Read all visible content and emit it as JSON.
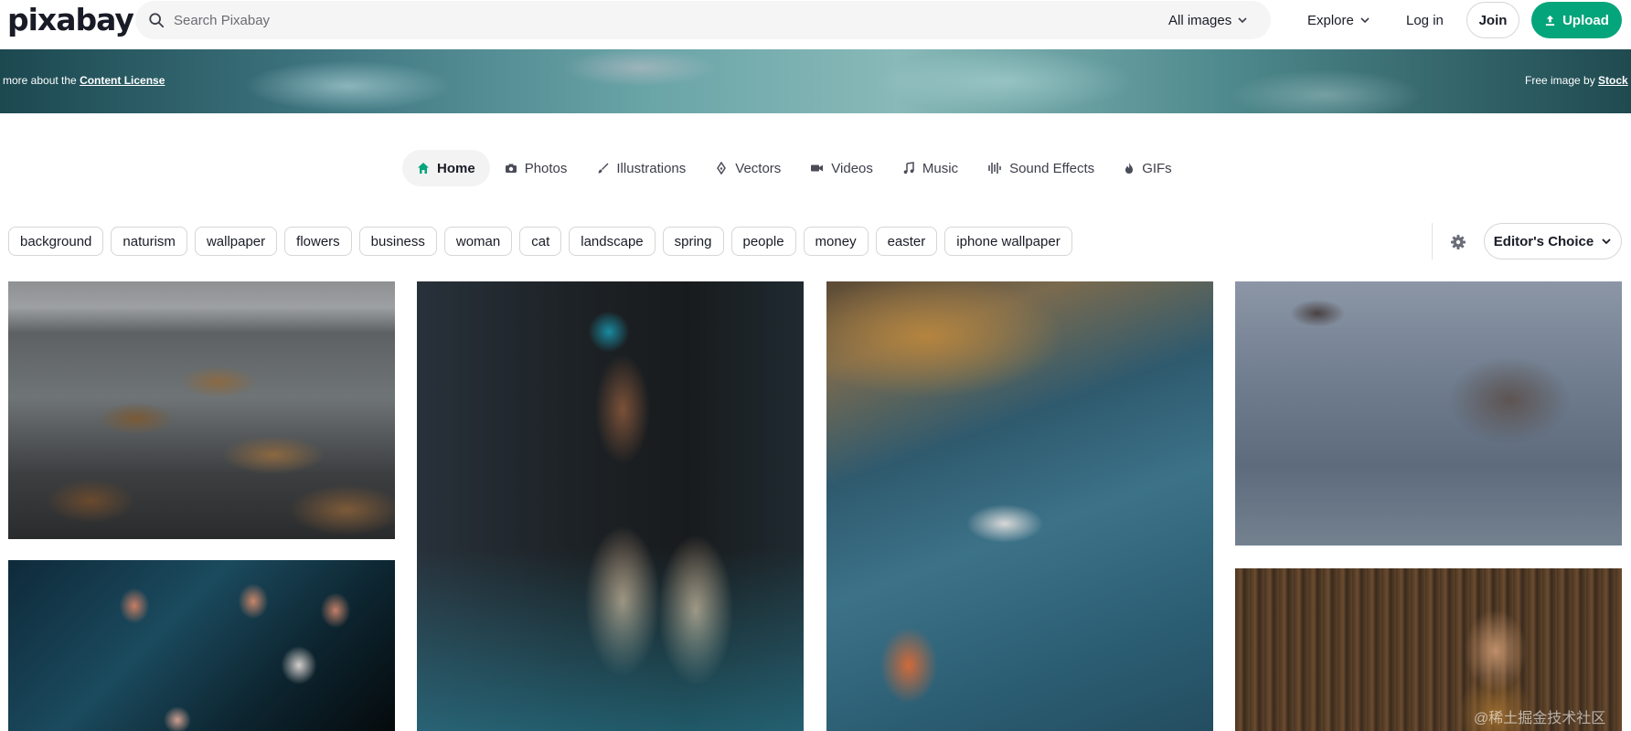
{
  "header": {
    "logo_text": "pixabay",
    "search_placeholder": "Search Pixabay",
    "filter_label": "All images",
    "explore_label": "Explore",
    "login_label": "Log in",
    "join_label": "Join",
    "upload_label": "Upload"
  },
  "banner": {
    "left_prefix": "more about the ",
    "left_link": "Content License",
    "right_prefix": "Free image by ",
    "right_link": "Stock"
  },
  "tabs": [
    {
      "label": "Home",
      "icon": "home-icon",
      "active": true
    },
    {
      "label": "Photos",
      "icon": "camera-icon",
      "active": false
    },
    {
      "label": "Illustrations",
      "icon": "brush-icon",
      "active": false
    },
    {
      "label": "Vectors",
      "icon": "pen-nib-icon",
      "active": false
    },
    {
      "label": "Videos",
      "icon": "video-icon",
      "active": false
    },
    {
      "label": "Music",
      "icon": "music-note-icon",
      "active": false
    },
    {
      "label": "Sound Effects",
      "icon": "sound-wave-icon",
      "active": false
    },
    {
      "label": "GIFs",
      "icon": "flame-icon",
      "active": false
    }
  ],
  "chips": [
    "background",
    "naturism",
    "wallpaper",
    "flowers",
    "business",
    "woman",
    "cat",
    "landscape",
    "spring",
    "people",
    "money",
    "easter",
    "iphone wallpaper"
  ],
  "sort": {
    "label": "Editor's Choice"
  },
  "photos": [
    {
      "name": "rocks-sea-photo"
    },
    {
      "name": "jellyfish-photo"
    },
    {
      "name": "sneakers-hand-photo"
    },
    {
      "name": "vintage-car-photo"
    },
    {
      "name": "hippo-water-photo"
    },
    {
      "name": "library-woman-photo"
    }
  ],
  "watermark": "@稀土掘金技术社区",
  "colors": {
    "brand_green": "#04a57a",
    "text_dark": "#191b26",
    "chip_border": "#d6d6d6"
  }
}
